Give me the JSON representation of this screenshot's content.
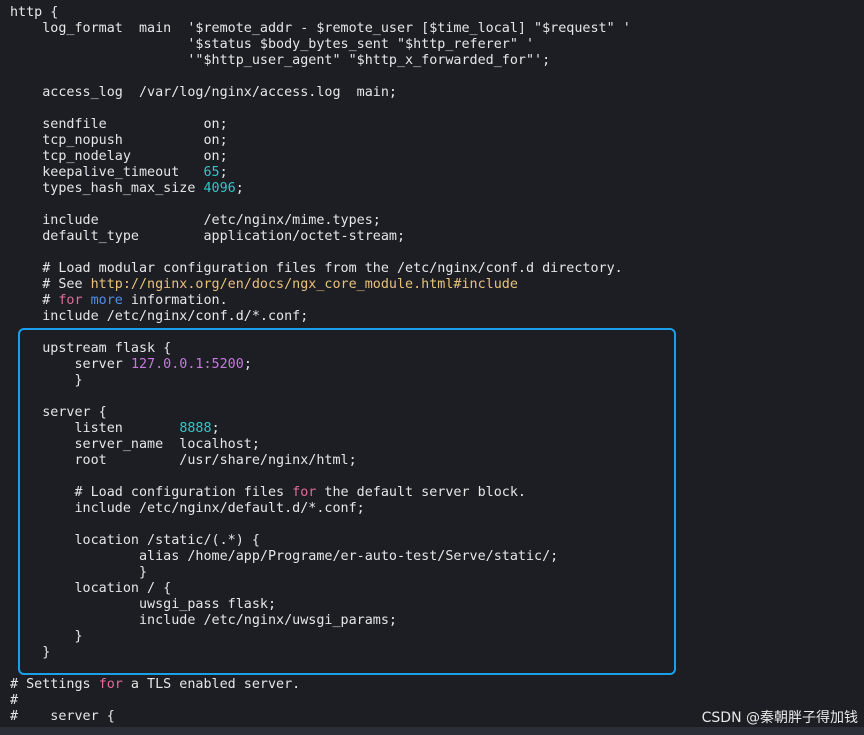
{
  "lines": [
    {
      "segs": [
        {
          "t": "http {"
        }
      ]
    },
    {
      "segs": [
        {
          "t": "    log_format  main  '$remote_addr - $remote_user [$time_local] \"$request\" '"
        }
      ]
    },
    {
      "segs": [
        {
          "t": "                      '$status $body_bytes_sent \"$http_referer\" '"
        }
      ]
    },
    {
      "segs": [
        {
          "t": "                      '\"$http_user_agent\" \"$http_x_forwarded_for\"';"
        }
      ]
    },
    {
      "segs": [
        {
          "t": ""
        }
      ]
    },
    {
      "segs": [
        {
          "t": "    access_log  /var/log/nginx/access.log  main;"
        }
      ]
    },
    {
      "segs": [
        {
          "t": ""
        }
      ]
    },
    {
      "segs": [
        {
          "t": "    sendfile            on;"
        }
      ]
    },
    {
      "segs": [
        {
          "t": "    tcp_nopush          on;"
        }
      ]
    },
    {
      "segs": [
        {
          "t": "    tcp_nodelay         on;"
        }
      ]
    },
    {
      "segs": [
        {
          "t": "    keepalive_timeout   "
        },
        {
          "t": "65",
          "c": "num"
        },
        {
          "t": ";"
        }
      ]
    },
    {
      "segs": [
        {
          "t": "    types_hash_max_size "
        },
        {
          "t": "4096",
          "c": "num"
        },
        {
          "t": ";"
        }
      ]
    },
    {
      "segs": [
        {
          "t": ""
        }
      ]
    },
    {
      "segs": [
        {
          "t": "    include             /etc/nginx/mime.types;"
        }
      ]
    },
    {
      "segs": [
        {
          "t": "    default_type        application/octet-stream;"
        }
      ]
    },
    {
      "segs": [
        {
          "t": ""
        }
      ]
    },
    {
      "segs": [
        {
          "t": "    # Load modular configuration files from the /etc/nginx/conf.d directory."
        }
      ]
    },
    {
      "segs": [
        {
          "t": "    # See "
        },
        {
          "t": "http://nginx.org/en/docs/ngx_core_module.html#include",
          "c": "url"
        }
      ]
    },
    {
      "segs": [
        {
          "t": "    # "
        },
        {
          "t": "for",
          "c": "kw"
        },
        {
          "t": " "
        },
        {
          "t": "more",
          "c": "blue"
        },
        {
          "t": " information."
        }
      ]
    },
    {
      "segs": [
        {
          "t": "    include /etc/nginx/conf.d/*.conf;"
        }
      ]
    },
    {
      "segs": [
        {
          "t": ""
        }
      ]
    },
    {
      "segs": [
        {
          "t": "    upstream flask {"
        }
      ]
    },
    {
      "segs": [
        {
          "t": "        server "
        },
        {
          "t": "127.0.0.1:5200",
          "c": "ip"
        },
        {
          "t": ";"
        }
      ]
    },
    {
      "segs": [
        {
          "t": "        }"
        }
      ]
    },
    {
      "segs": [
        {
          "t": ""
        }
      ]
    },
    {
      "segs": [
        {
          "t": "    server {"
        }
      ]
    },
    {
      "segs": [
        {
          "t": "        listen       "
        },
        {
          "t": "8888",
          "c": "num"
        },
        {
          "t": ";"
        }
      ]
    },
    {
      "segs": [
        {
          "t": "        server_name  localhost;"
        }
      ]
    },
    {
      "segs": [
        {
          "t": "        root         /usr/share/nginx/html;"
        }
      ]
    },
    {
      "segs": [
        {
          "t": ""
        }
      ]
    },
    {
      "segs": [
        {
          "t": "        # Load configuration files "
        },
        {
          "t": "for",
          "c": "kw"
        },
        {
          "t": " the default server block."
        }
      ]
    },
    {
      "segs": [
        {
          "t": "        include /etc/nginx/default.d/*.conf;"
        }
      ]
    },
    {
      "segs": [
        {
          "t": ""
        }
      ]
    },
    {
      "segs": [
        {
          "t": "        location /static/(.*) {"
        }
      ]
    },
    {
      "segs": [
        {
          "t": "                alias /home/app/Programe/er-auto-test/Serve/static/;"
        }
      ]
    },
    {
      "segs": [
        {
          "t": "                }"
        }
      ]
    },
    {
      "segs": [
        {
          "t": "        location / {"
        }
      ]
    },
    {
      "segs": [
        {
          "t": "                uwsgi_pass flask;"
        }
      ]
    },
    {
      "segs": [
        {
          "t": "                include /etc/nginx/uwsgi_params;"
        }
      ]
    },
    {
      "segs": [
        {
          "t": "        }"
        }
      ]
    },
    {
      "segs": [
        {
          "t": "    }"
        }
      ]
    },
    {
      "segs": [
        {
          "t": ""
        }
      ]
    },
    {
      "segs": [
        {
          "t": "# Settings "
        },
        {
          "t": "for",
          "c": "kw"
        },
        {
          "t": " a TLS enabled server."
        }
      ]
    },
    {
      "segs": [
        {
          "t": "#"
        }
      ]
    },
    {
      "segs": [
        {
          "t": "#    server {"
        }
      ]
    }
  ],
  "watermark": "CSDN @秦朝胖子得加钱",
  "colors": {
    "keyword": "#e06c9a",
    "number": "#33c7c3",
    "url": "#e8c27a",
    "ip": "#c678dd",
    "highlight_border": "#1aa0e8"
  }
}
